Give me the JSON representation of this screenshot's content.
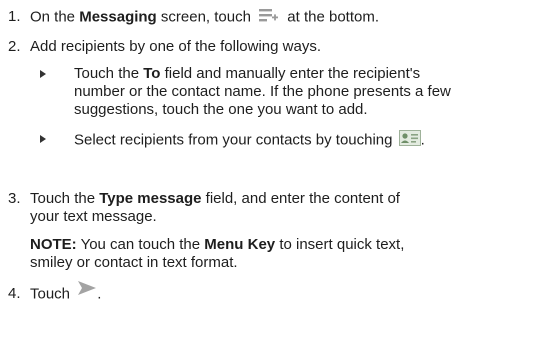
{
  "steps": [
    {
      "num": "1.",
      "pre": "On the ",
      "bold": "Messaging",
      "post": " screen, touch",
      "post2": " at the bottom."
    },
    {
      "num": "2.",
      "text": "Add recipients by one of the following ways."
    },
    {
      "num": "3.",
      "pre": "Touch the ",
      "bold": "Type message",
      "post": " field, and enter the content of",
      "line2": "your text message."
    },
    {
      "num": "4.",
      "text": "Touch",
      "end": "."
    }
  ],
  "bullets": [
    {
      "pre": "Touch the ",
      "bold": "To",
      "post": " field and manually enter the recipient's",
      "line2": "number or the contact name. If the phone presents a few",
      "line3": "suggestions, touch the one you want to add."
    },
    {
      "text": "Select recipients from your contacts by touching",
      "end": "."
    }
  ],
  "note": {
    "label": "NOTE:",
    "pre": " You can touch the ",
    "bold": "Menu Key",
    "post": " to insert quick text,",
    "line2": "smiley or contact in text format."
  },
  "icons": {
    "compose": "compose-icon",
    "contacts": "contacts-icon",
    "send": "send-icon"
  }
}
